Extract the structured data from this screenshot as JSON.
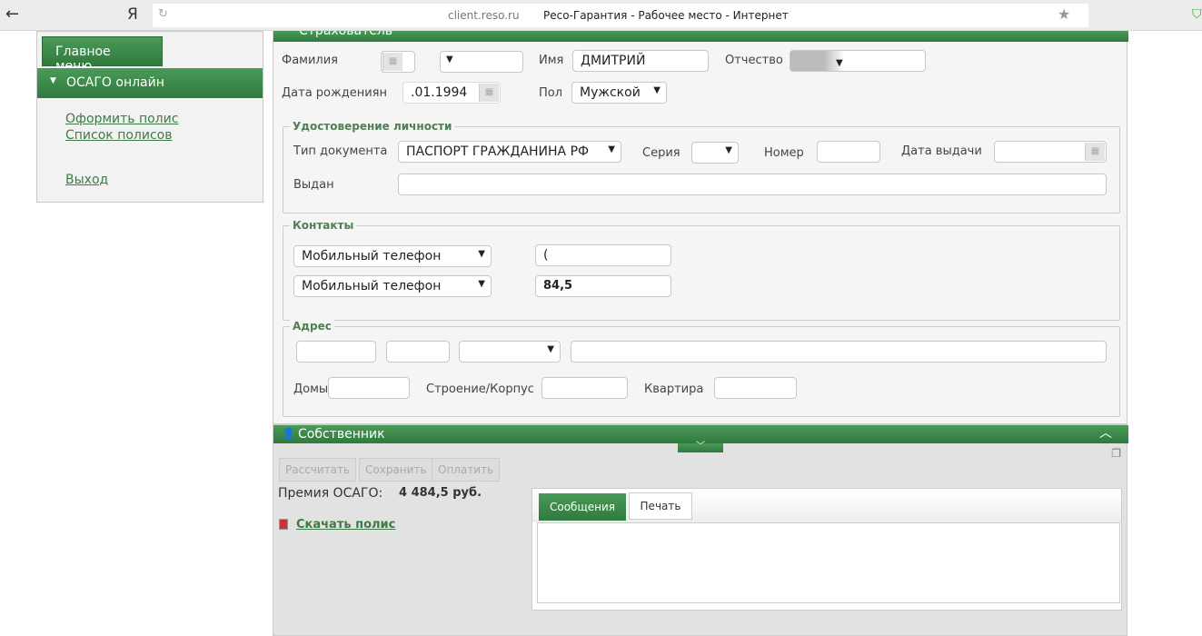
{
  "browser": {
    "back_icon": "arrow-left-icon",
    "logo": "Я",
    "url": "client.reso.ru",
    "page_title": "Ресо-Гарантия - Рабочее место - Интернет"
  },
  "sidebar": {
    "main_menu": "Главное меню",
    "section": "ОСАГО онлайн",
    "items": [
      {
        "label": "Оформить полис"
      },
      {
        "label": "Список полисов"
      },
      {
        "label": "Выход"
      }
    ]
  },
  "insurer": {
    "title": "Страхователь",
    "surname_label": "Фамилия",
    "name_label": "Имя",
    "name_value": "ДМИТРИЙ",
    "patronymic_label": "Отчество",
    "birth_label": "Дата рождениян",
    "birth_value": ".01.1994",
    "gender_label": "Пол",
    "gender_value": "Мужской",
    "identity": {
      "legend": "Удостоверение личности",
      "doc_type_label": "Тип документа",
      "doc_type_value": "ПАСПОРТ ГРАЖДАНИНА РФ",
      "series_label": "Серия",
      "number_label": "Номер",
      "issue_date_label": "Дата выдачи",
      "issued_by_label": "Выдан"
    },
    "contacts": {
      "legend": "Контакты",
      "phone1_type": "Мобильный телефон",
      "phone1_value": "(",
      "phone2_type": "Мобильный телефон",
      "phone2_value": "84,5"
    },
    "address": {
      "legend": "Адрес",
      "house_label": "Домы",
      "building_label": "Строение/Корпус",
      "apartment_label": "Квартира"
    }
  },
  "owner": {
    "title": "Собственник",
    "buttons": {
      "calculate": "Рассчитать",
      "save": "Сохранить",
      "pay": "Оплатить"
    },
    "premium_label": "Премия ОСАГО:",
    "premium_value": "4 484,5 руб.",
    "download_label": "Скачать полис",
    "tabs": [
      {
        "label": "Сообщения",
        "active": true
      },
      {
        "label": "Печать",
        "active": false
      }
    ]
  },
  "colors": {
    "accent": "#3a8a4a",
    "link": "#3d7a45"
  }
}
